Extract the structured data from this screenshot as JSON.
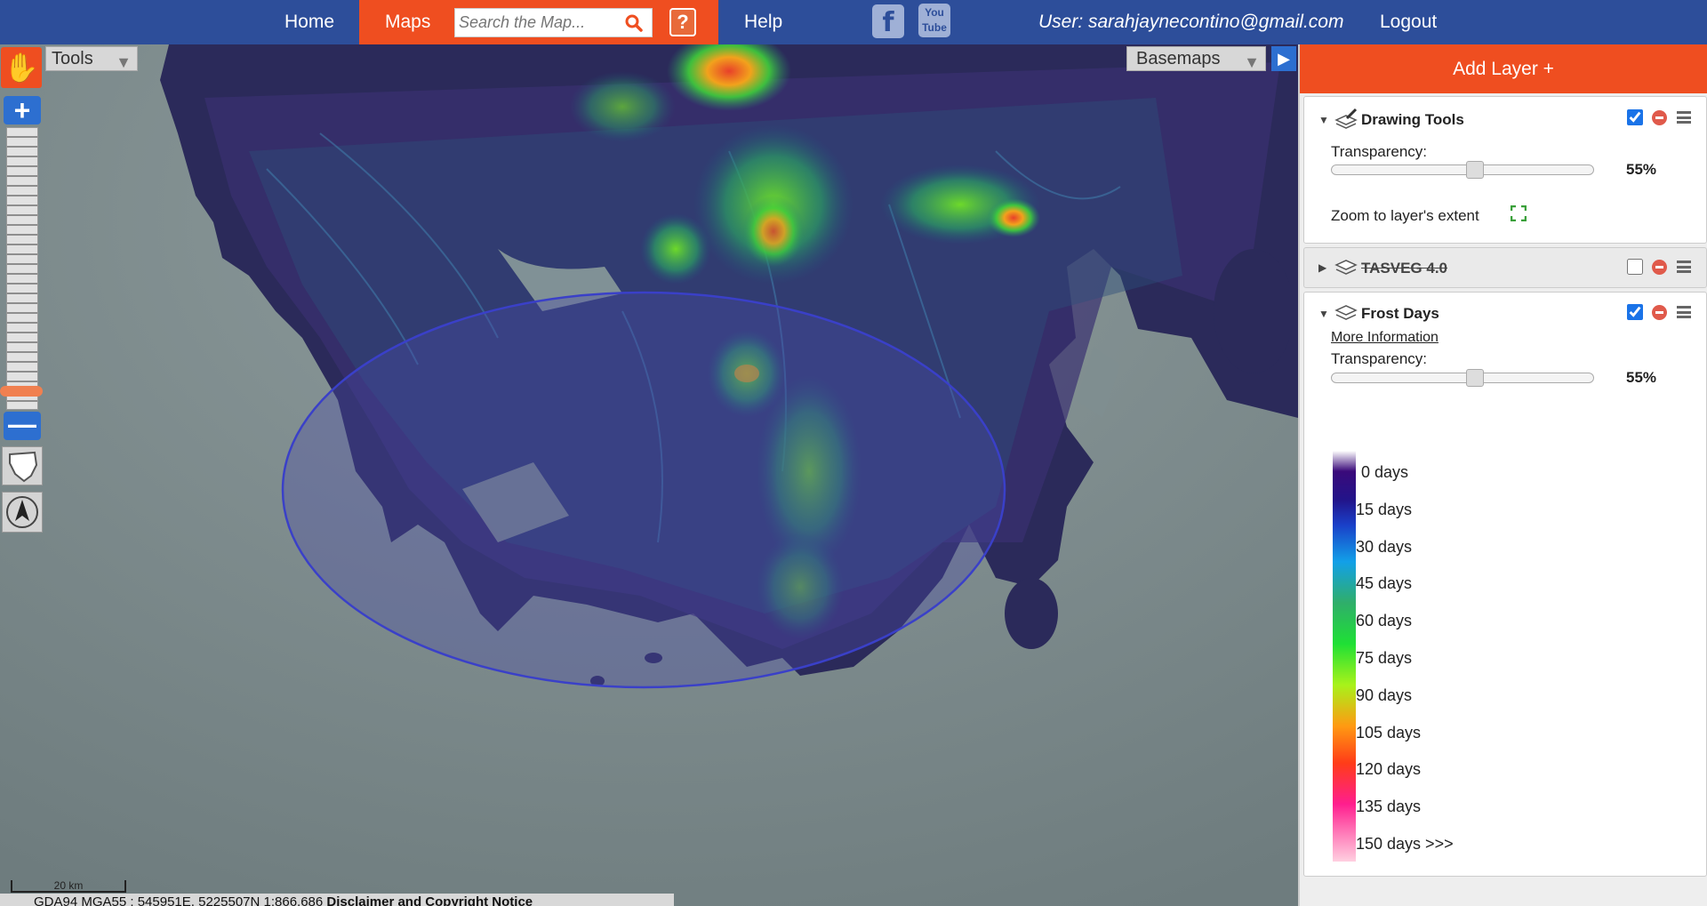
{
  "nav": {
    "home": "Home",
    "maps": "Maps",
    "search_placeholder": "Search the Map...",
    "help_icon": "?",
    "help": "Help",
    "facebook_icon": "f",
    "youtube_icon": "You Tube",
    "user": "User: sarahjaynecontino@gmail.com",
    "logout": "Logout"
  },
  "map": {
    "tools_label": "Tools",
    "basemaps_label": "Basemaps",
    "scale_label": "20 km",
    "footer_coords": "GDA94 MGA55 : 545951E, 5225507N 1:866,686",
    "footer_disclaimer": "Disclaimer and Copyright Notice",
    "zoom_level_fraction": 0.06
  },
  "panel": {
    "add_layer": "Add Layer +",
    "layers": [
      {
        "title": "Drawing Tools",
        "checked": true,
        "transparency_label": "Transparency:",
        "transparency_value": "55%",
        "transparency": 0.55,
        "zoom_extent": "Zoom to layer's extent"
      },
      {
        "title": "TASVEG 4.0",
        "checked": false
      },
      {
        "title": "Frost Days",
        "checked": true,
        "more_info": "More Information",
        "transparency_label": "Transparency:",
        "transparency_value": "55%",
        "transparency": 0.55
      }
    ],
    "legend": [
      "0 days",
      "15 days",
      "30 days",
      "45 days",
      "60 days",
      "75 days",
      "90 days",
      "105 days",
      "120 days",
      "135 days",
      "150 days >>>"
    ]
  },
  "colors": {
    "nav_bg": "#2d4e9a",
    "accent": "#ef4e20",
    "sea": "#7f8e90",
    "land": "#2a2a5a",
    "circle_fill": "#4a4aa8"
  }
}
